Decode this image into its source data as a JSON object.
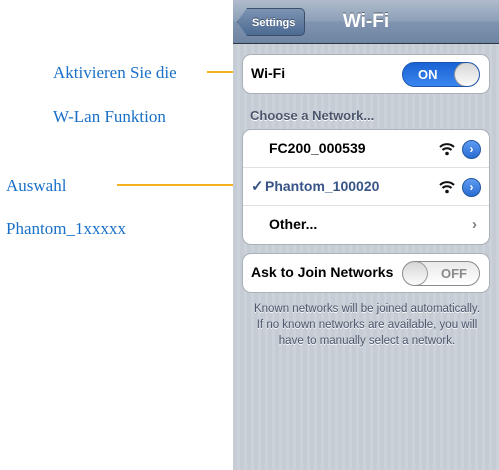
{
  "annotations": {
    "activate_line1": "Aktivieren Sie die",
    "activate_line2": "W-Lan Funktion",
    "select_line1": "Auswahl",
    "select_line2": "Phantom_1xxxxx"
  },
  "navbar": {
    "back_label": "Settings",
    "title": "Wi-Fi"
  },
  "wifi_toggle": {
    "label": "Wi-Fi",
    "state": "ON"
  },
  "networks": {
    "header": "Choose a Network...",
    "items": [
      {
        "name": "FC200_000539",
        "selected": false,
        "icon": "wifi-icon"
      },
      {
        "name": "Phantom_100020",
        "selected": true,
        "checkmark": "✓",
        "icon": "wifi-icon"
      }
    ],
    "other_label": "Other...",
    "other_chevron": "›",
    "detail_glyph": "›"
  },
  "ask_to_join": {
    "label": "Ask to Join Networks",
    "state": "OFF"
  },
  "footer": "Known networks will be joined automatically. If no known networks are available, you will have to manually select a network.",
  "colors": {
    "annotation_text": "#1a70c8",
    "callout_line": "#f2b21b",
    "toggle_on": "#2a78e6",
    "selected_network": "#385487"
  }
}
